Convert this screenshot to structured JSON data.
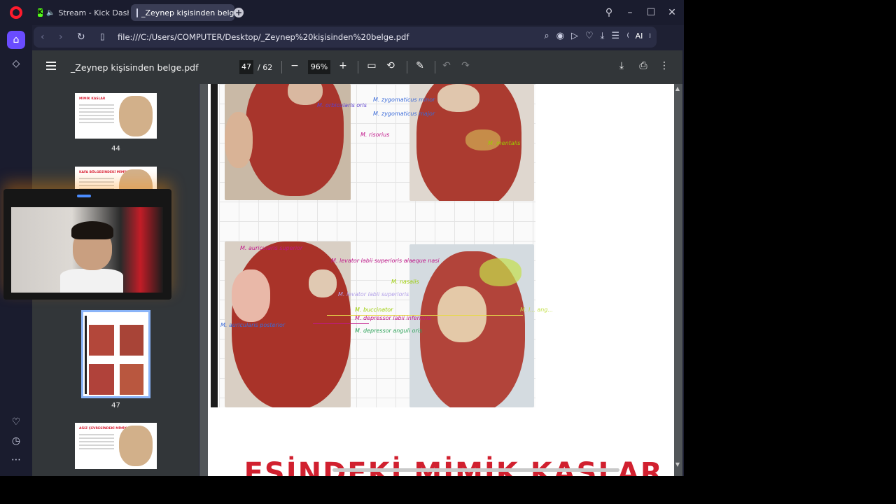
{
  "tabs": [
    {
      "label": "Stream - Kick Dashboa",
      "icon": "kick-icon",
      "speaker_icon": "speaker-icon"
    },
    {
      "label": "_Zeynep kişisinden belge.",
      "icon": "pdf-icon"
    }
  ],
  "addressbar": {
    "url": "file:///C:/Users/COMPUTER/Desktop/_Zeynep%20kişisinden%20belge.pdf",
    "ai_label": "AI"
  },
  "pdf": {
    "title": "_Zeynep kişisinden belge.pdf",
    "current_page": "47",
    "total_pages": "/ 62",
    "zoom": "96%"
  },
  "thumbnails": [
    {
      "page": "44",
      "title": "MİMİK KASLAR"
    },
    {
      "page": "",
      "title": "KAFA BÖLGESİNDEKİ MİMİK KASLAR"
    },
    {
      "page": "47",
      "title": ""
    },
    {
      "page": "",
      "title": "AĞIZ ÇEVRESİNDEKİ MİMİK KASLAR"
    }
  ],
  "page_labels": {
    "top_left": "M. orbicularis oris",
    "top_mid1": "M. zygomaticus minor",
    "top_mid2": "M. zygomaticus major",
    "top_mid3": "M. risorius",
    "top_right": "M. mentalis",
    "bottom_l1": "M. auricularis superior",
    "bottom_l2": "M. levator labii superioris alaeque nasi",
    "bottom_l3": "M. nasalis",
    "bottom_l4": "M. levator labii superioris",
    "bottom_l5": "M. buccinator",
    "bottom_l6": "M. depressor labii inferioris",
    "bottom_l7": "M. depressor anguli oris",
    "bottom_l8": "M. auricularis posterior",
    "bottom_right": "M. l... ang..."
  },
  "next_page_heading": "...ESİNDEKİ MİMİK KASLAR",
  "colors": {
    "accent": "#6a4cff",
    "heading_red": "#d1202f"
  }
}
